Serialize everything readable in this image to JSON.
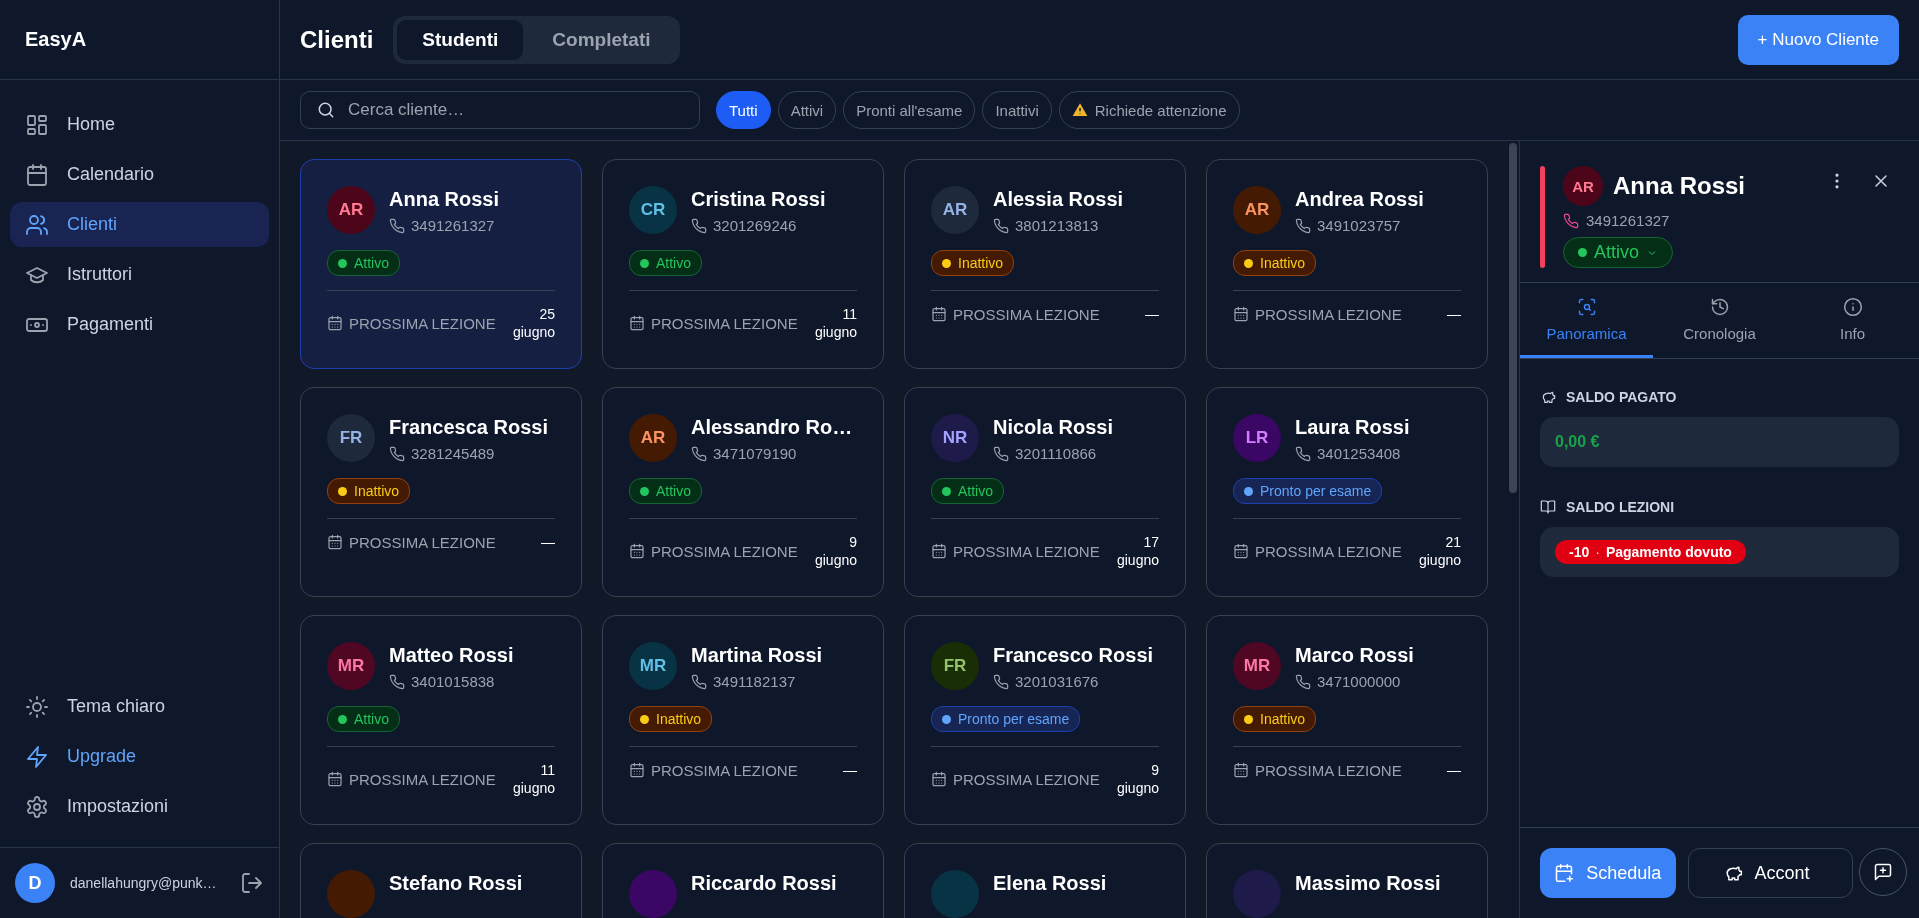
{
  "sidebar": {
    "logo": "EasyA",
    "nav": [
      {
        "label": "Home",
        "selected": false
      },
      {
        "label": "Calendario",
        "selected": false
      },
      {
        "label": "Clienti",
        "selected": true
      },
      {
        "label": "Istruttori",
        "selected": false
      },
      {
        "label": "Pagamenti",
        "selected": false
      }
    ],
    "bottom": [
      {
        "label": "Tema chiaro",
        "kind": "normal"
      },
      {
        "label": "Upgrade",
        "kind": "accent"
      },
      {
        "label": "Impostazioni",
        "kind": "normal"
      }
    ],
    "user": {
      "initial": "D",
      "email": "danellahungry@punk…"
    }
  },
  "header": {
    "title": "Clienti",
    "tabs": [
      {
        "label": "Studenti",
        "selected": true
      },
      {
        "label": "Completati",
        "selected": false
      }
    ],
    "new_button": "+ Nuovo Cliente"
  },
  "search": {
    "placeholder": "Cerca cliente…"
  },
  "filters": [
    {
      "label": "Tutti",
      "selected": true,
      "kind": "plain"
    },
    {
      "label": "Attivi",
      "selected": false,
      "kind": "plain"
    },
    {
      "label": "Pronti all'esame",
      "selected": false,
      "kind": "plain"
    },
    {
      "label": "Inattivi",
      "selected": false,
      "kind": "plain"
    },
    {
      "label": "Richiede attenzione",
      "selected": false,
      "kind": "warning"
    }
  ],
  "clients": [
    {
      "initials": "AR",
      "name": "Anna Rossi",
      "phone": "3491261327",
      "kind": "active",
      "status_label": "Attivo",
      "next_label": "PROSSIMA LEZIONE",
      "next_date": "25 giugno",
      "selected": true,
      "color": "#4c0519"
    },
    {
      "initials": "CR",
      "name": "Cristina Rossi",
      "phone": "3201269246",
      "kind": "active",
      "status_label": "Attivo",
      "next_label": "PROSSIMA LEZIONE",
      "next_date": "11 giugno",
      "selected": false,
      "color": "#083344"
    },
    {
      "initials": "AR",
      "name": "Alessia Rossi",
      "phone": "3801213813",
      "kind": "inactive",
      "status_label": "Inattivo",
      "next_label": "PROSSIMA LEZIONE",
      "next_date": "—",
      "selected": false,
      "color": "#1e293b"
    },
    {
      "initials": "AR",
      "name": "Andrea Rossi",
      "phone": "3491023757",
      "kind": "inactive",
      "status_label": "Inattivo",
      "next_label": "PROSSIMA LEZIONE",
      "next_date": "—",
      "selected": false,
      "color": "#451a03"
    },
    {
      "initials": "FR",
      "name": "Francesca Rossi",
      "phone": "3281245489",
      "kind": "inactive",
      "status_label": "Inattivo",
      "next_label": "PROSSIMA LEZIONE",
      "next_date": "—",
      "selected": false,
      "color": "#1e293b"
    },
    {
      "initials": "AR",
      "name": "Alessandro Ro…",
      "phone": "3471079190",
      "kind": "active",
      "status_label": "Attivo",
      "next_label": "PROSSIMA LEZIONE",
      "next_date": "9 giugno",
      "selected": false,
      "color": "#451a03"
    },
    {
      "initials": "NR",
      "name": "Nicola Rossi",
      "phone": "3201110866",
      "kind": "active",
      "status_label": "Attivo",
      "next_label": "PROSSIMA LEZIONE",
      "next_date": "17 giugno",
      "selected": false,
      "color": "#1e1b4b"
    },
    {
      "initials": "LR",
      "name": "Laura Rossi",
      "phone": "3401253408",
      "kind": "ready",
      "status_label": "Pronto per esame",
      "next_label": "PROSSIMA LEZIONE",
      "next_date": "21 giugno",
      "selected": false,
      "color": "#3b0764"
    },
    {
      "initials": "MR",
      "name": "Matteo Rossi",
      "phone": "3401015838",
      "kind": "active",
      "status_label": "Attivo",
      "next_label": "PROSSIMA LEZIONE",
      "next_date": "11 giugno",
      "selected": false,
      "color": "#500724"
    },
    {
      "initials": "MR",
      "name": "Martina Rossi",
      "phone": "3491182137",
      "kind": "inactive",
      "status_label": "Inattivo",
      "next_label": "PROSSIMA LEZIONE",
      "next_date": "—",
      "selected": false,
      "color": "#083344"
    },
    {
      "initials": "FR",
      "name": "Francesco Rossi",
      "phone": "3201031676",
      "kind": "ready",
      "status_label": "Pronto per esame",
      "next_label": "PROSSIMA LEZIONE",
      "next_date": "9 giugno",
      "selected": false,
      "color": "#1a2e05"
    },
    {
      "initials": "MR",
      "name": "Marco Rossi",
      "phone": "3471000000",
      "kind": "inactive",
      "status_label": "Inattivo",
      "next_label": "PROSSIMA LEZIONE",
      "next_date": "—",
      "selected": false,
      "color": "#500724"
    },
    {
      "name": "Stefano Rossi",
      "selected": false,
      "color": "#451a03"
    },
    {
      "name": "Riccardo Rossi",
      "selected": false,
      "color": "#3b0764"
    },
    {
      "name": "Elena Rossi",
      "selected": false,
      "color": "#083344"
    },
    {
      "name": "Massimo Rossi",
      "selected": false,
      "color": "#1e1b4b"
    }
  ],
  "detail": {
    "initials": "AR",
    "name": "Anna Rossi",
    "phone": "3491261327",
    "kind": "active",
    "status_label": "Attivo",
    "color": "#4c0519",
    "tabs": [
      {
        "label": "Panoramica",
        "selected": true
      },
      {
        "label": "Cronologia",
        "selected": false
      },
      {
        "label": "Info",
        "selected": false
      }
    ],
    "sections": [
      {
        "kind": "paid",
        "title": "SALDO PAGATO",
        "value": "0,00 €"
      },
      {
        "kind": "lessons",
        "title": "SALDO LEZIONI",
        "count": "-10",
        "separator": "·",
        "note": "Pagamento dovuto"
      }
    ],
    "actions": [
      {
        "label": "Schedula",
        "kind": "primary"
      },
      {
        "label": "Accont",
        "kind": "secondary"
      }
    ]
  }
}
